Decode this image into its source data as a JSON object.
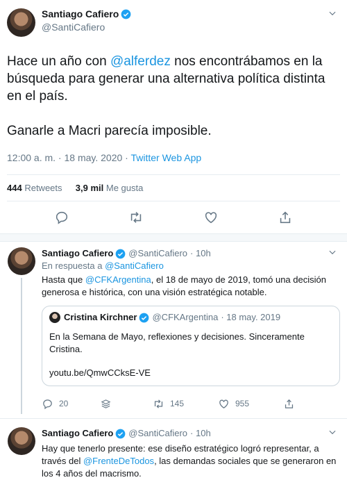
{
  "main_tweet": {
    "author": {
      "name": "Santiago Cafiero",
      "handle": "@SantiCafiero"
    },
    "text": {
      "line1_prefix": "Hace un año con ",
      "mention": "@alferdez",
      "line1_suffix": " nos encontrábamos en la búsqueda para generar una alternativa política distinta en el país.",
      "paragraph2": "Ganarle a Macri parecía imposible."
    },
    "timestamp": "12:00 a. m. · 18 may. 2020 · ",
    "source": "Twitter Web App",
    "stats": {
      "retweets_count": "444",
      "retweets_label": "Retweets",
      "likes_count": "3,9 mil",
      "likes_label": "Me gusta"
    },
    "actions": [
      "reply-icon",
      "retweet-icon",
      "like-icon",
      "share-icon"
    ]
  },
  "reply1": {
    "author": {
      "name": "Santiago Cafiero",
      "handle": "@SantiCafiero",
      "time": "· 10h"
    },
    "in_reply_label": "En respuesta a ",
    "in_reply_handle": "@SantiCafiero",
    "text_prefix": "Hasta que ",
    "mention": "@CFKArgentina",
    "text_suffix": ", el 18 de mayo de 2019, tomó una decisión generosa e histórica, con una visión estratégica notable.",
    "quote": {
      "name": "Cristina Kirchner",
      "handle": "@CFKArgentina",
      "date": "· 18 may. 2019",
      "text": "En la Semana de Mayo, reflexiones y decisiones. Sinceramente Cristina.",
      "link": "youtu.be/QmwCCksE-VE"
    },
    "actions": {
      "replies": "20",
      "retweets": "145",
      "likes": "955"
    }
  },
  "reply2": {
    "author": {
      "name": "Santiago Cafiero",
      "handle": "@SantiCafiero",
      "time": "· 10h"
    },
    "text_prefix": "Hay que tenerlo presente: ese diseño estratégico logró representar, a través del ",
    "mention": "@FrenteDeTodos",
    "text_suffix": ", las demandas sociales que se generaron en los 4 años del macrismo."
  },
  "colors": {
    "accent": "#1da1f2",
    "link": "#1b95e0",
    "muted": "#657786",
    "border": "#e6ecf0"
  }
}
